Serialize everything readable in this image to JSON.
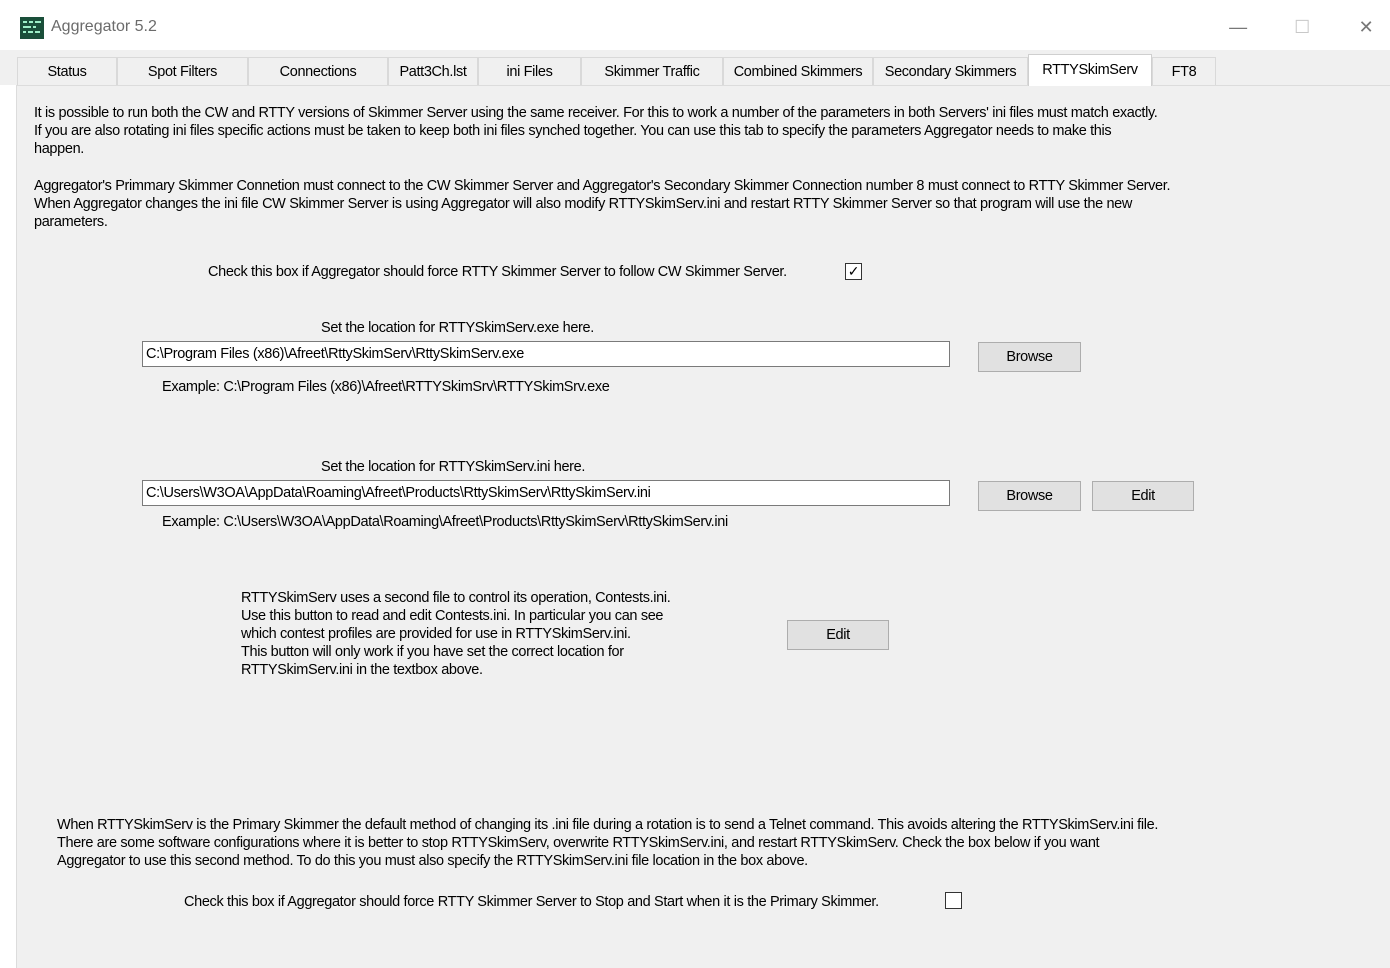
{
  "window": {
    "title": "Aggregator 5.2",
    "minimize": "—",
    "maximize": "☐",
    "close": "✕"
  },
  "tabs": [
    {
      "label": "Status"
    },
    {
      "label": "Spot Filters"
    },
    {
      "label": "Connections"
    },
    {
      "label": "Patt3Ch.lst"
    },
    {
      "label": "ini Files"
    },
    {
      "label": "Skimmer Traffic"
    },
    {
      "label": "Combined Skimmers"
    },
    {
      "label": "Secondary Skimmers"
    },
    {
      "label": "RTTYSkimServ",
      "active": true
    },
    {
      "label": "FT8"
    }
  ],
  "intro": {
    "lines": [
      "It is possible to run both the CW and RTTY versions of Skimmer Server using the same receiver.  For this to work a number of the parameters in both Servers' ini files must match exactly.",
      "If you are also rotating ini files specific actions must be taken to keep both ini files synched together.  You can use this tab to specify the parameters Aggregator needs to make this",
      "happen."
    ]
  },
  "connection_note": {
    "lines": [
      "Aggregator's Primmary Skimmer Connetion must connect to the CW Skimmer Server and Aggregator's Secondary Skimmer Connection number 8 must connect to RTTY Skimmer Server.",
      "When Aggregator changes the ini file CW Skimmer Server is using Aggregator will also modify RTTYSkimServ.ini and restart RTTY Skimmer Server so that program will use the new",
      "parameters."
    ]
  },
  "follow_cw": {
    "label": "Check this box if Aggregator should force RTTY Skimmer Server to follow CW Skimmer Server.",
    "checked": true,
    "mark": "✓"
  },
  "exe": {
    "label": "Set the location for RTTYSkimServ.exe here.",
    "value": "C:\\Program Files (x86)\\Afreet\\RttySkimServ\\RttySkimServ.exe",
    "browse": "Browse",
    "example": "Example: C:\\Program Files (x86)\\Afreet\\RTTYSkimSrv\\RTTYSkimSrv.exe"
  },
  "ini": {
    "label": "Set the location for RTTYSkimServ.ini here.",
    "value": "C:\\Users\\W3OA\\AppData\\Roaming\\Afreet\\Products\\RttySkimServ\\RttySkimServ.ini",
    "browse": "Browse",
    "edit": "Edit",
    "example": "Example: C:\\Users\\W3OA\\AppData\\Roaming\\Afreet\\Products\\RttySkimServ\\RttySkimServ.ini"
  },
  "contests": {
    "lines": [
      "RTTYSkimServ uses a second file to control its operation, Contests.ini.",
      "Use this button to read and edit Contests.ini.  In particular you can see",
      "which contest profiles are provided for use in RTTYSkimServ.ini.",
      "This button will only work if you have set the correct location for",
      "RTTYSkimServ.ini in the textbox above."
    ],
    "edit": "Edit"
  },
  "primary_note": {
    "lines": [
      "When RTTYSkimServ is the Primary Skimmer the default method of changing its .ini file during a rotation is to send a Telnet command.  This avoids altering the RTTYSkimServ.ini file.",
      "There are some software configurations where it is better to stop RTTYSkimServ, overwrite RTTYSkimServ.ini, and restart RTTYSkimServ.  Check the box below if you want",
      "Aggregator to use this second method.  To do this you must also specify the RTTYSkimServ.ini file location in the box above."
    ]
  },
  "stop_start": {
    "label": "Check this box if Aggregator should force RTTY Skimmer Server to Stop and Start when it is the Primary Skimmer.",
    "checked": false,
    "mark": ""
  }
}
